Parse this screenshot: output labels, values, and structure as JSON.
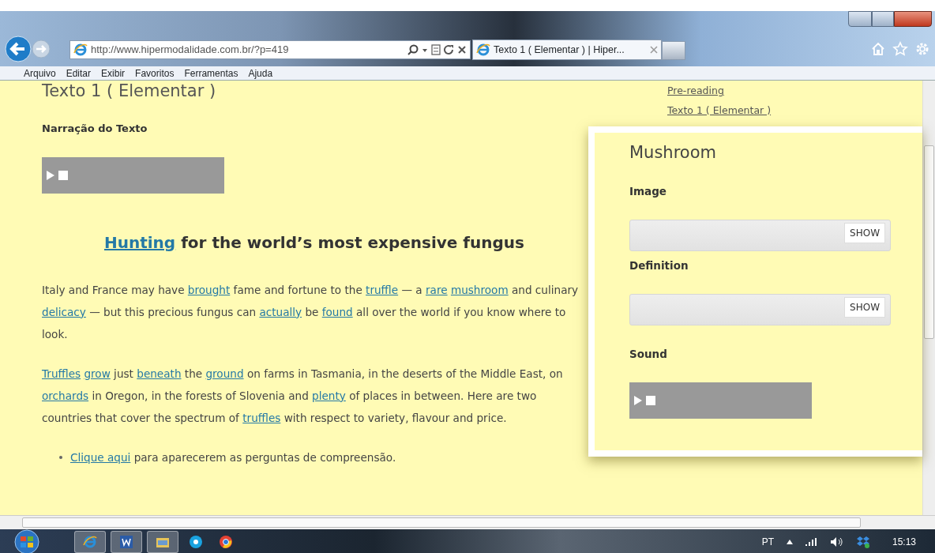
{
  "browser": {
    "address": "http://www.hipermodalidade.com.br/?p=419",
    "tab_title": "Texto 1 ( Elementar ) | Hiper...",
    "menu": [
      "Arquivo",
      "Editar",
      "Exibir",
      "Favoritos",
      "Ferramentas",
      "Ajuda"
    ]
  },
  "page": {
    "title": "Texto 1 ( Elementar )",
    "narration_label": "Narração do Texto",
    "headline": [
      {
        "link": "Hunting"
      },
      " for the world’s most expensive fungus"
    ],
    "paragraphs": [
      [
        "Italy and France may have ",
        {
          "link": "brought"
        },
        " fame and fortune to the ",
        {
          "link": "truffle"
        },
        " — a ",
        {
          "link": "rare"
        },
        {
          "link": "mushroom"
        },
        " and culinary ",
        {
          "link": "delicacy"
        },
        " — but this precious fungus can ",
        {
          "link": "actually"
        },
        " be ",
        {
          "link": "found"
        },
        " all over the world if you know where to look."
      ],
      [
        {
          "link": "Truffles"
        },
        {
          "link": "grow"
        },
        " just ",
        {
          "link": "beneath"
        },
        " the ",
        {
          "link": "ground"
        },
        " on farms in Tasmania, in the deserts of the Middle East, on ",
        {
          "link": "orchards"
        },
        " in Oregon, in the forests of Slovenia and ",
        {
          "link": "plenty"
        },
        " of places in between. Here are two countries that cover the spectrum of ",
        {
          "link": "truffles"
        },
        " with respect to variety, flavour and price."
      ]
    ],
    "bullets": [
      [
        {
          "link": "Clique aqui"
        },
        " para aparecerem as perguntas de compreensão."
      ]
    ],
    "sidebar_links": [
      "Pre-reading",
      "Texto 1 ( Elementar )"
    ]
  },
  "popup": {
    "title": "Mushroom",
    "sections": [
      {
        "kind": "reveal",
        "label": "Image",
        "button": "SHOW"
      },
      {
        "kind": "reveal",
        "label": "Definition",
        "button": "SHOW"
      },
      {
        "kind": "audio",
        "label": "Sound"
      }
    ]
  },
  "taskbar": {
    "language": "PT",
    "time": "15:13"
  }
}
